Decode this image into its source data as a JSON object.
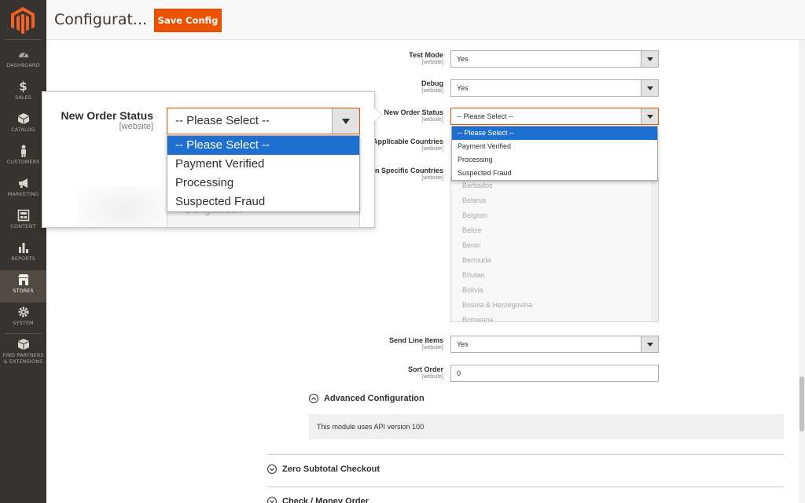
{
  "sidebar": {
    "items": [
      {
        "label": "DASHBOARD",
        "icon": "dashboard-icon"
      },
      {
        "label": "SALES",
        "icon": "dollar-icon"
      },
      {
        "label": "CATALOG",
        "icon": "cube-icon"
      },
      {
        "label": "CUSTOMERS",
        "icon": "person-icon"
      },
      {
        "label": "MARKETING",
        "icon": "megaphone-icon"
      },
      {
        "label": "CONTENT",
        "icon": "layout-icon"
      },
      {
        "label": "REPORTS",
        "icon": "bar-chart-icon"
      },
      {
        "label": "STORES",
        "icon": "store-icon"
      },
      {
        "label": "SYSTEM",
        "icon": "gear-icon"
      },
      {
        "label": "FIND PARTNERS & EXTENSIONS",
        "icon": "box-icon"
      }
    ]
  },
  "header": {
    "title": "Configurat...",
    "save_label": "Save Config"
  },
  "form": {
    "test_mode": {
      "label": "Test Mode",
      "scope": "[website]",
      "value": "Yes"
    },
    "debug": {
      "label": "Debug",
      "scope": "[website]",
      "value": "Yes"
    },
    "new_order_status": {
      "label": "New Order Status",
      "scope": "[website]",
      "value": "-- Please Select --",
      "options": [
        "-- Please Select --",
        "Payment Verified",
        "Processing",
        "Suspected Fraud"
      ]
    },
    "applicable_countries": {
      "label": "Applicable Countries",
      "scope": "[website]"
    },
    "specific_countries": {
      "label": "n Specific Countries",
      "scope": "[website]",
      "options": [
        "Barbados",
        "Belarus",
        "Belgium",
        "Belize",
        "Benin",
        "Bermuda",
        "Bhutan",
        "Bolivia",
        "Bosnia & Herzegovina",
        "Botswana"
      ]
    },
    "send_line_items": {
      "label": "Send Line Items",
      "scope": "[website]",
      "value": "Yes"
    },
    "sort_order": {
      "label": "Sort Order",
      "scope": "[website]",
      "value": "0"
    }
  },
  "advanced": {
    "title": "Advanced Configuration",
    "note": "This module uses API version 100"
  },
  "sections": {
    "zero_subtotal": "Zero Subtotal Checkout",
    "check_money": "Check / Money Order"
  },
  "callout": {
    "label": "New Order Status",
    "scope": "[website]",
    "value": "-- Please Select --",
    "options": [
      "-- Please Select --",
      "Payment Verified",
      "Processing",
      "Suspected Fraud"
    ],
    "behind_text": "Bangladesh"
  },
  "colors": {
    "accent": "#eb5202",
    "sidebar_bg": "#373330",
    "highlight": "#1e6fd0"
  }
}
